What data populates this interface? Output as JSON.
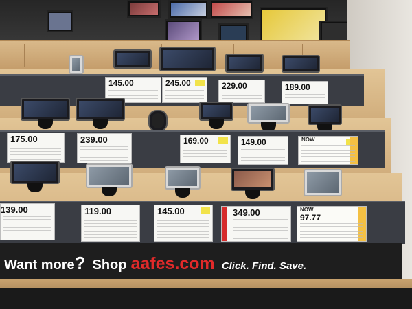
{
  "scene": {
    "description_hidden": "",
    "banner": {
      "want_more": "Want more",
      "question_mark": "?",
      "shop": "Shop",
      "site": "aafes.com",
      "tagline": "Click. Find. Save."
    },
    "tier1": {
      "prices": [
        "145.00",
        "245.00",
        "229.00",
        "189.00"
      ]
    },
    "tier2": {
      "prices": [
        "175.00",
        "239.00",
        "169.00",
        "149.00",
        "NOW"
      ]
    },
    "tier3": {
      "prices": [
        "139.00",
        "119.00",
        "145.00",
        "349.00",
        "NOW",
        "97.77"
      ]
    },
    "colors": {
      "rail": "#3a3d44",
      "shelf": "#d8b88a",
      "banner": "#1e1e1e",
      "brand_red": "#e12a2a"
    }
  }
}
